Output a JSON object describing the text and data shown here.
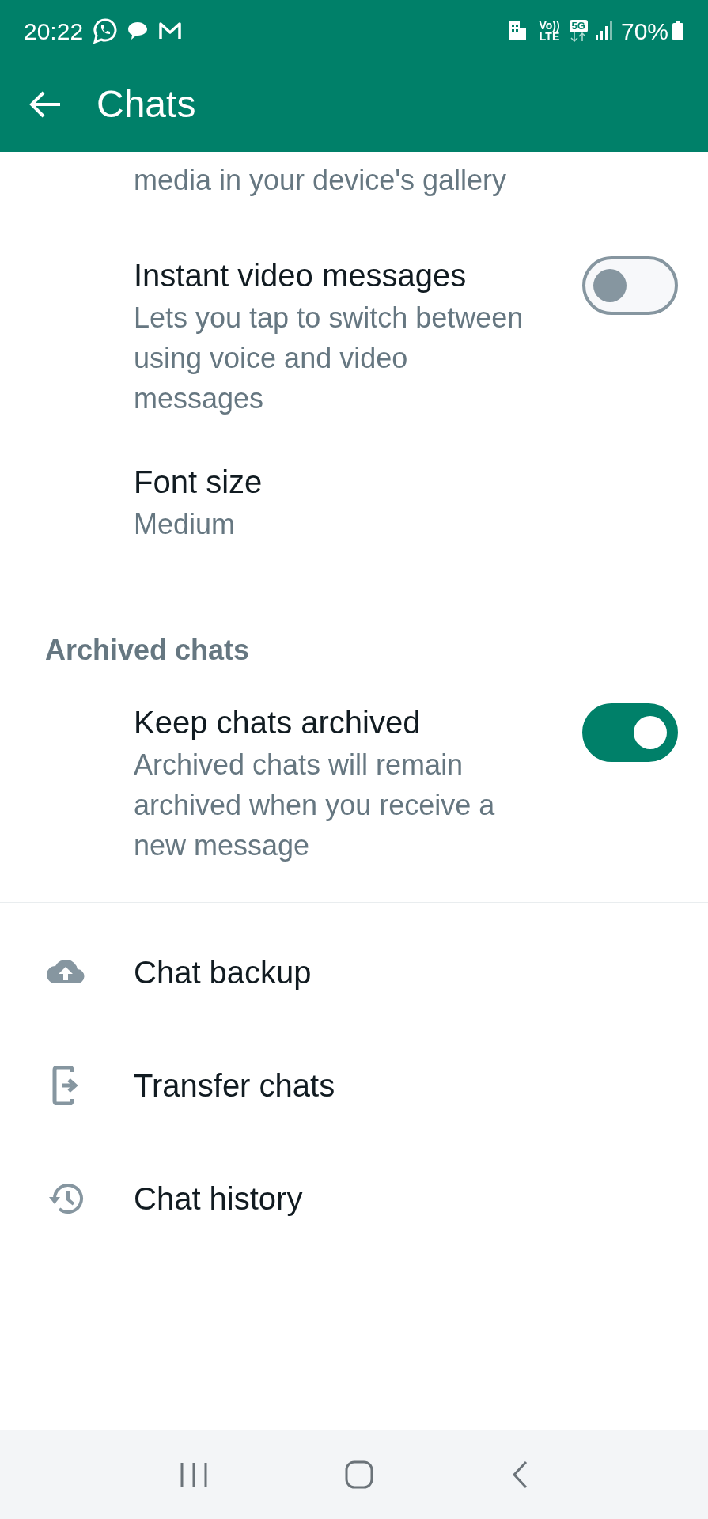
{
  "status_bar": {
    "time": "20:22",
    "volte_top": "Vo))",
    "volte_bottom": "LTE",
    "network_type": "5G",
    "battery": "70%"
  },
  "header": {
    "title": "Chats"
  },
  "sections": [
    {
      "items": [
        {
          "kind": "continuation",
          "description": "media in your device's gallery"
        },
        {
          "kind": "toggle",
          "title": "Instant video messages",
          "description": "Lets you tap to switch between using voice and video messages",
          "on": false
        },
        {
          "kind": "value",
          "title": "Font size",
          "description": "Medium"
        }
      ]
    },
    {
      "heading": "Archived chats",
      "items": [
        {
          "kind": "toggle",
          "title": "Keep chats archived",
          "description": "Archived chats will remain archived when you receive a new message",
          "on": true
        }
      ]
    },
    {
      "items": [
        {
          "kind": "link",
          "title": "Chat backup"
        },
        {
          "kind": "link",
          "title": "Transfer chats"
        },
        {
          "kind": "link",
          "title": "Chat history"
        }
      ]
    }
  ]
}
